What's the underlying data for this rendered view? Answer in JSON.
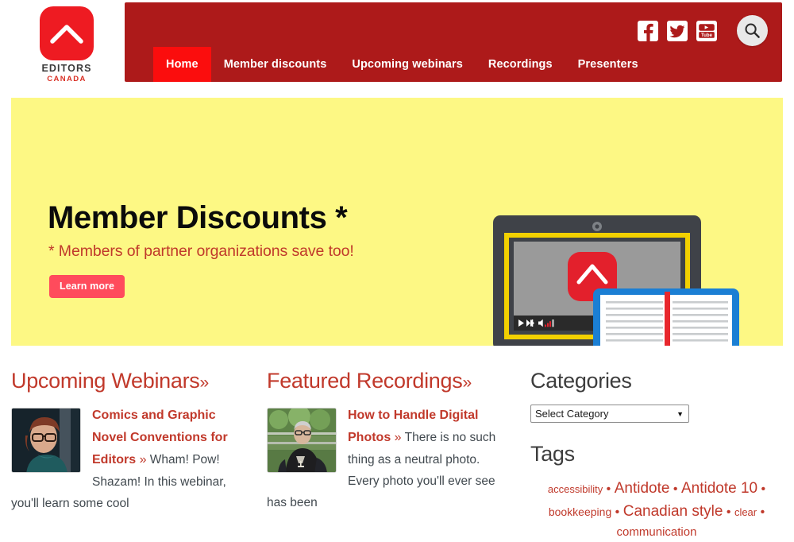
{
  "brand": {
    "logo_editors": "EDITORS",
    "logo_canada": "CANADA",
    "accent_red": "#ee1b22",
    "nav_red": "#ad1a1a",
    "active_red": "#fb0d0d",
    "hero_yellow": "#fdf884",
    "link_red": "#c1392b"
  },
  "header": {
    "nav": [
      {
        "label": "Home",
        "active": true
      },
      {
        "label": "Member discounts",
        "active": false
      },
      {
        "label": "Upcoming webinars",
        "active": false
      },
      {
        "label": "Recordings",
        "active": false
      },
      {
        "label": "Presenters",
        "active": false
      }
    ],
    "social": [
      {
        "name": "facebook-icon",
        "label": "Facebook"
      },
      {
        "name": "twitter-icon",
        "label": "Twitter"
      },
      {
        "name": "youtube-icon",
        "label": "YouTube"
      }
    ],
    "search_label": "Search"
  },
  "hero": {
    "title": "Member Discounts *",
    "subtitle": "* Members of partner organizations save too!",
    "button_label": "Learn more",
    "slide_indicator": "1",
    "art": {
      "screen_label": "video player",
      "player_controls": [
        "play",
        "skip",
        "volume",
        "signal"
      ]
    }
  },
  "upcoming": {
    "heading": "Upcoming Webinars",
    "chevron": "»",
    "item": {
      "title": "Comics and Graphic Novel Conventions for Editors",
      "chevron": "»",
      "excerpt": "Wham! Pow! Shazam! In this webinar, you'll learn some cool",
      "thumb_alt": "presenter portrait"
    }
  },
  "recordings": {
    "heading": "Featured Recordings",
    "chevron": "»",
    "item": {
      "title": "How to Handle Digital Photos",
      "chevron": "»",
      "excerpt": "There is no such thing as a neutral photo. Every photo you'll ever see has been",
      "thumb_alt": "presenter photo outdoors"
    }
  },
  "sidebar": {
    "categories_heading": "Categories",
    "category_selected": "Select Category",
    "category_options": [
      "Select Category"
    ],
    "tags_heading": "Tags",
    "tags": [
      {
        "label": "accessibility",
        "size": 13
      },
      {
        "label": "Antidote",
        "size": 19
      },
      {
        "label": "Antidote 10",
        "size": 19
      },
      {
        "label": "bookkeeping",
        "size": 14
      },
      {
        "label": "Canadian style",
        "size": 19
      },
      {
        "label": "clear",
        "size": 13
      },
      {
        "label": "communication",
        "size": 15
      }
    ],
    "tag_separator": "•"
  }
}
